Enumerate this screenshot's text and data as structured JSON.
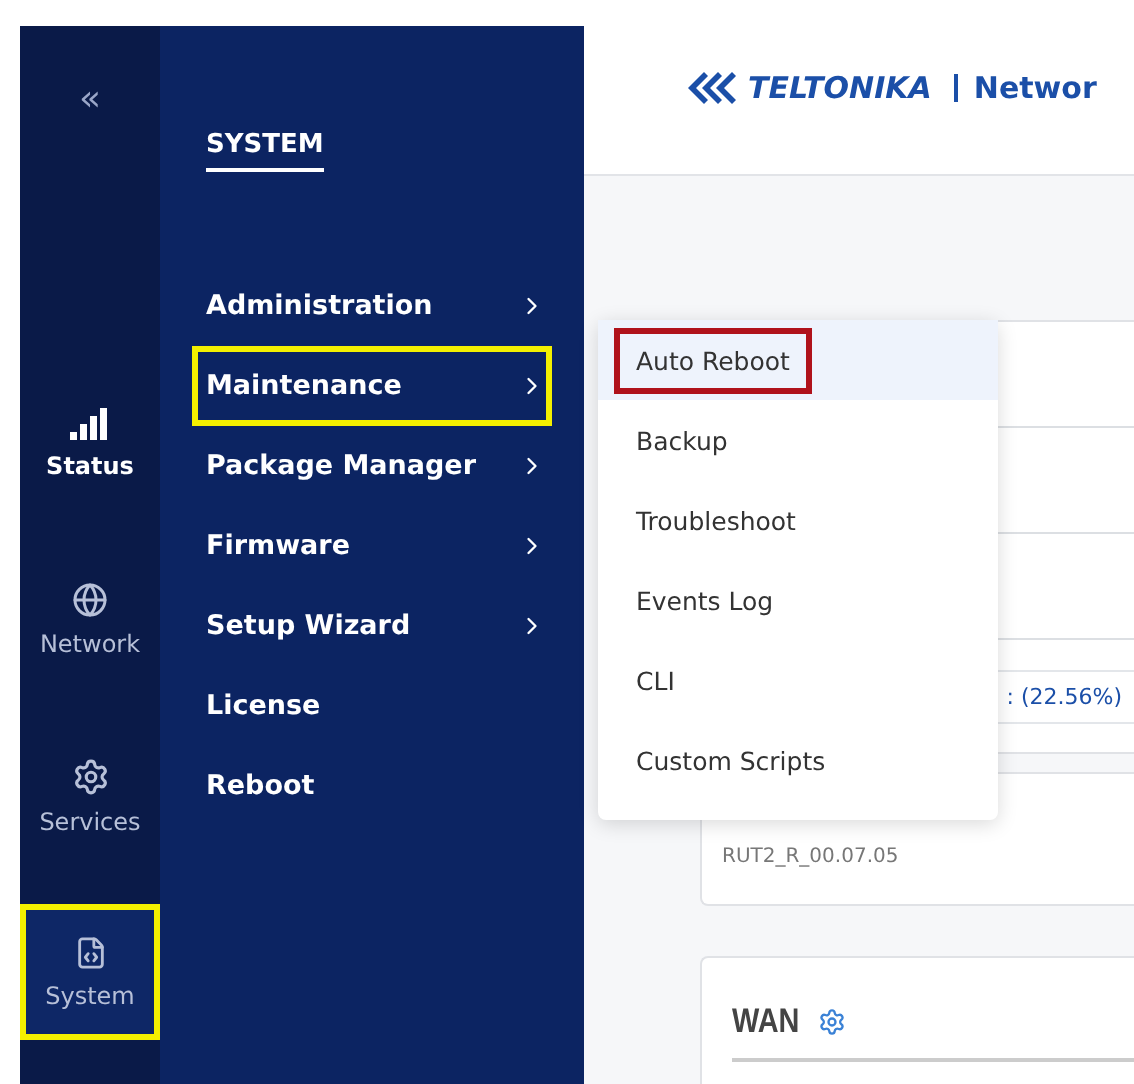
{
  "rail": {
    "collapse": "«",
    "items": [
      {
        "label": "Status",
        "selected": false,
        "emphasized": true,
        "annotated": false
      },
      {
        "label": "Network",
        "selected": false,
        "emphasized": false,
        "annotated": false
      },
      {
        "label": "Services",
        "selected": false,
        "emphasized": false,
        "annotated": false
      },
      {
        "label": "System",
        "selected": true,
        "emphasized": false,
        "annotated": true
      }
    ]
  },
  "submenu": {
    "title": "SYSTEM",
    "items": [
      {
        "label": "Administration",
        "has_submenu": true,
        "annotated": false
      },
      {
        "label": "Maintenance",
        "has_submenu": true,
        "annotated": true
      },
      {
        "label": "Package Manager",
        "has_submenu": true,
        "annotated": false
      },
      {
        "label": "Firmware",
        "has_submenu": true,
        "annotated": false
      },
      {
        "label": "Setup Wizard",
        "has_submenu": true,
        "annotated": false
      },
      {
        "label": "License",
        "has_submenu": false,
        "annotated": false
      },
      {
        "label": "Reboot",
        "has_submenu": false,
        "annotated": false
      }
    ]
  },
  "popup": {
    "items": [
      {
        "label": "Auto Reboot",
        "selected": true,
        "annotated": true
      },
      {
        "label": "Backup",
        "selected": false,
        "annotated": false
      },
      {
        "label": "Troubleshoot",
        "selected": false,
        "annotated": false
      },
      {
        "label": "Events Log",
        "selected": false,
        "annotated": false
      },
      {
        "label": "CLI",
        "selected": false,
        "annotated": false
      },
      {
        "label": "Custom Scripts",
        "selected": false,
        "annotated": false
      }
    ]
  },
  "header": {
    "logo": "TELTONIKA",
    "product": "Networ"
  },
  "content": {
    "usage": ": (22.56%)",
    "firmware": "RUT2_R_00.07.05",
    "wan_title": "WAN"
  }
}
